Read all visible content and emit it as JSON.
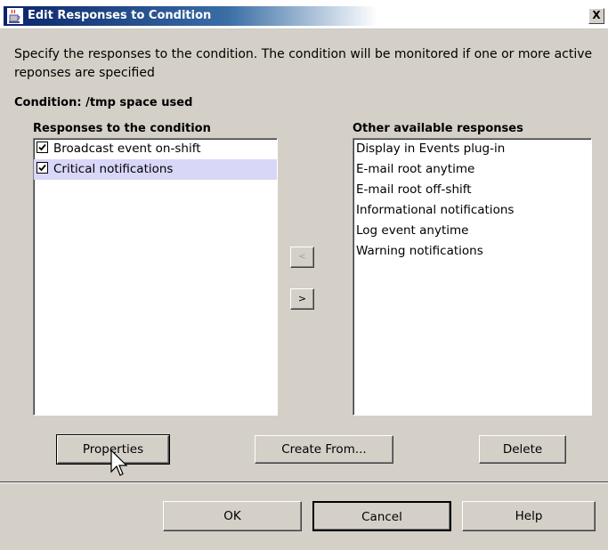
{
  "window": {
    "title": "Edit Responses to Condition",
    "close_glyph": "X"
  },
  "description": "Specify the responses to the condition. The condition will be monitored if one or more active reponses are specified",
  "condition_label": "Condition: /tmp space used",
  "left_panel": {
    "header": "Responses to the condition",
    "items": [
      {
        "label": "Broadcast event on-shift",
        "checked": true,
        "selected": false
      },
      {
        "label": "Critical notifications",
        "checked": true,
        "selected": true
      }
    ]
  },
  "right_panel": {
    "header": "Other available responses",
    "items": [
      {
        "label": "Display in Events plug-in"
      },
      {
        "label": "E-mail root anytime"
      },
      {
        "label": "E-mail root off-shift"
      },
      {
        "label": "Informational notifications"
      },
      {
        "label": "Log event anytime"
      },
      {
        "label": "Warning notifications"
      }
    ]
  },
  "move_buttons": {
    "left_label": "<",
    "right_label": ">"
  },
  "actions": {
    "properties": "Properties",
    "create_from": "Create From...",
    "delete": "Delete"
  },
  "footer": {
    "ok": "OK",
    "cancel": "Cancel",
    "help": "Help"
  },
  "colors": {
    "background": "#d4d0c8",
    "selection": "#d9d7f8",
    "title_gradient_start": "#0a246a"
  }
}
